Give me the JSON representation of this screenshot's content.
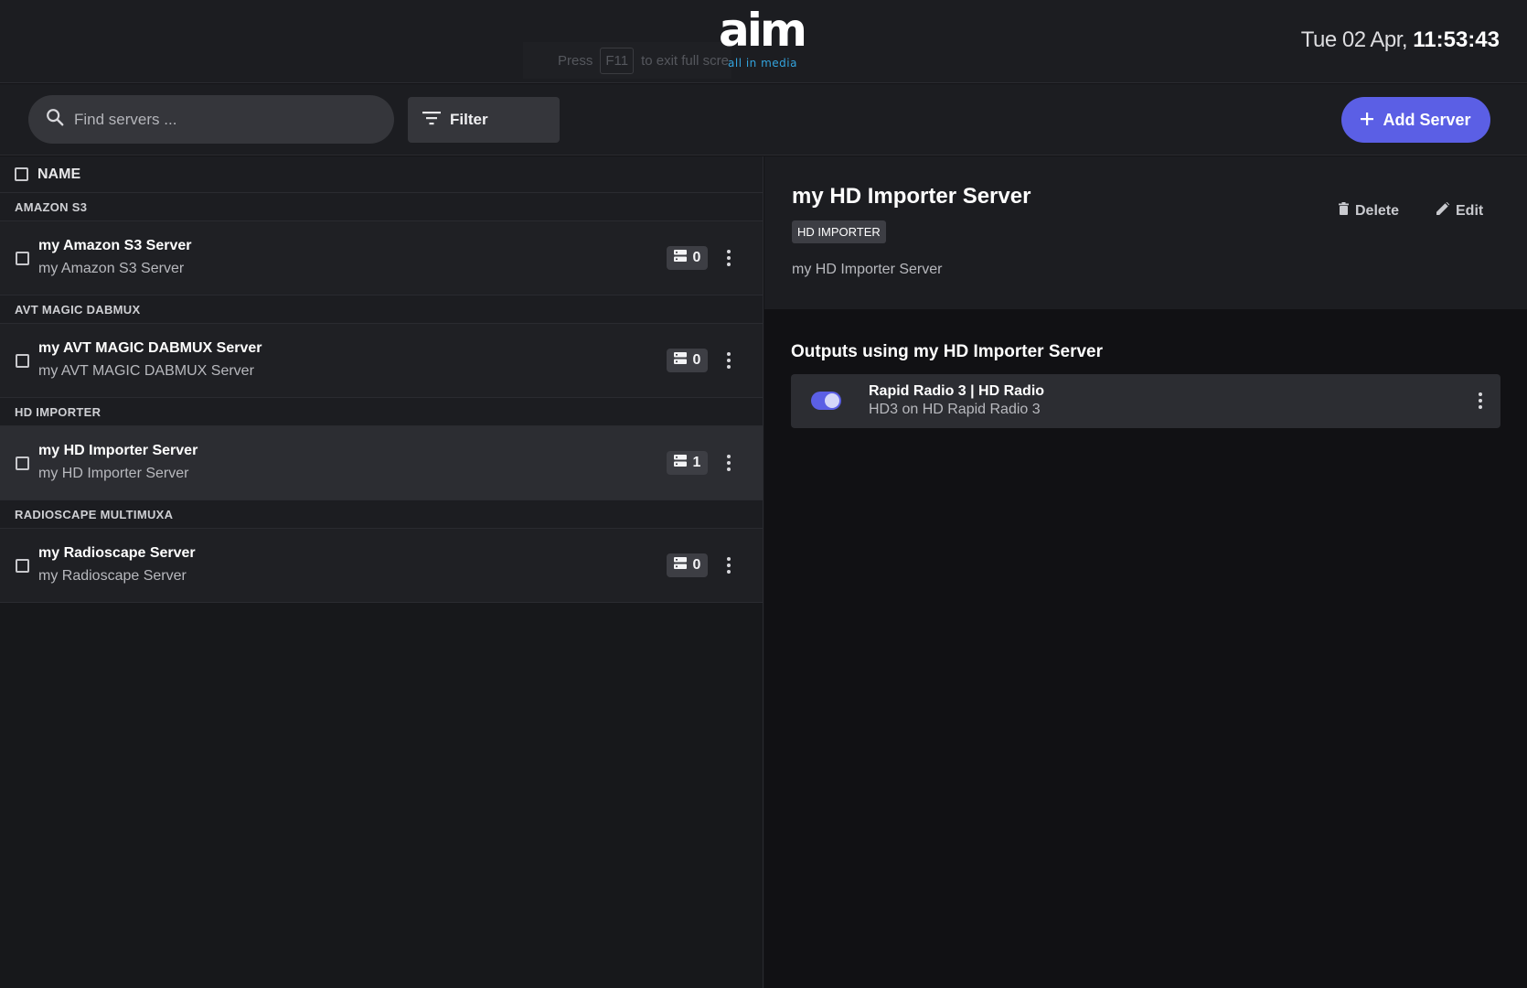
{
  "header": {
    "f11_hint": {
      "press": "Press",
      "key": "F11",
      "rest": "to exit full scre"
    },
    "logo": {
      "main": "aim",
      "sub": "all in media"
    },
    "clock": {
      "date": "Tue 02 Apr, ",
      "time": "11:53:43"
    }
  },
  "toolbar": {
    "search_placeholder": "Find servers ...",
    "filter_label": "Filter",
    "add_label": "Add Server"
  },
  "list": {
    "column_header": "NAME",
    "groups": [
      {
        "label": "AMAZON S3",
        "items": [
          {
            "title": "my Amazon S3 Server",
            "subtitle": "my Amazon S3 Server",
            "count": "0",
            "selected": false
          }
        ]
      },
      {
        "label": "AVT MAGIC DABMUX",
        "items": [
          {
            "title": "my AVT MAGIC DABMUX Server",
            "subtitle": "my AVT MAGIC DABMUX Server",
            "count": "0",
            "selected": false
          }
        ]
      },
      {
        "label": "HD IMPORTER",
        "items": [
          {
            "title": "my HD Importer Server",
            "subtitle": "my HD Importer Server",
            "count": "1",
            "selected": true
          }
        ]
      },
      {
        "label": "RADIOSCAPE MULTIMUXA",
        "items": [
          {
            "title": "my Radioscape Server",
            "subtitle": "my Radioscape Server",
            "count": "0",
            "selected": false
          }
        ]
      }
    ]
  },
  "detail": {
    "title": "my HD Importer Server",
    "type_badge": "HD IMPORTER",
    "description": "my HD Importer Server",
    "delete_label": "Delete",
    "edit_label": "Edit",
    "outputs_title": "Outputs using my HD Importer Server",
    "outputs": [
      {
        "title": "Rapid Radio 3 | HD Radio",
        "subtitle": "HD3 on HD Rapid Radio 3",
        "enabled": true
      }
    ]
  },
  "colors": {
    "accent": "#5b5fe5",
    "logo_sub": "#33a3dd",
    "background": "#141417",
    "panel": "#1c1d21"
  },
  "icons": [
    "search-icon",
    "filter-icon",
    "plus-icon",
    "server-icon",
    "kebab-menu-icon",
    "trash-icon",
    "pencil-icon"
  ]
}
